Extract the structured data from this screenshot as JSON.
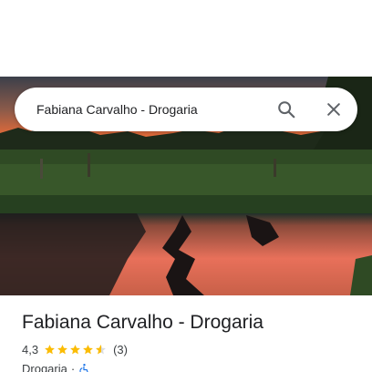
{
  "search": {
    "query": "Fabiana Carvalho - Drogaria",
    "search_icon": "search-icon",
    "close_icon": "close-icon"
  },
  "hero": {
    "image": "sunset-pond-photo"
  },
  "place": {
    "name": "Fabiana Carvalho - Drogaria",
    "rating": "4,3",
    "rating_fraction": 0.86,
    "review_count": "(3)",
    "category": "Drogaria",
    "separator": "·",
    "accessibility_icon": "wheelchair-icon",
    "star_color": "#fbbc04",
    "accessibility_color": "#1a73e8"
  }
}
